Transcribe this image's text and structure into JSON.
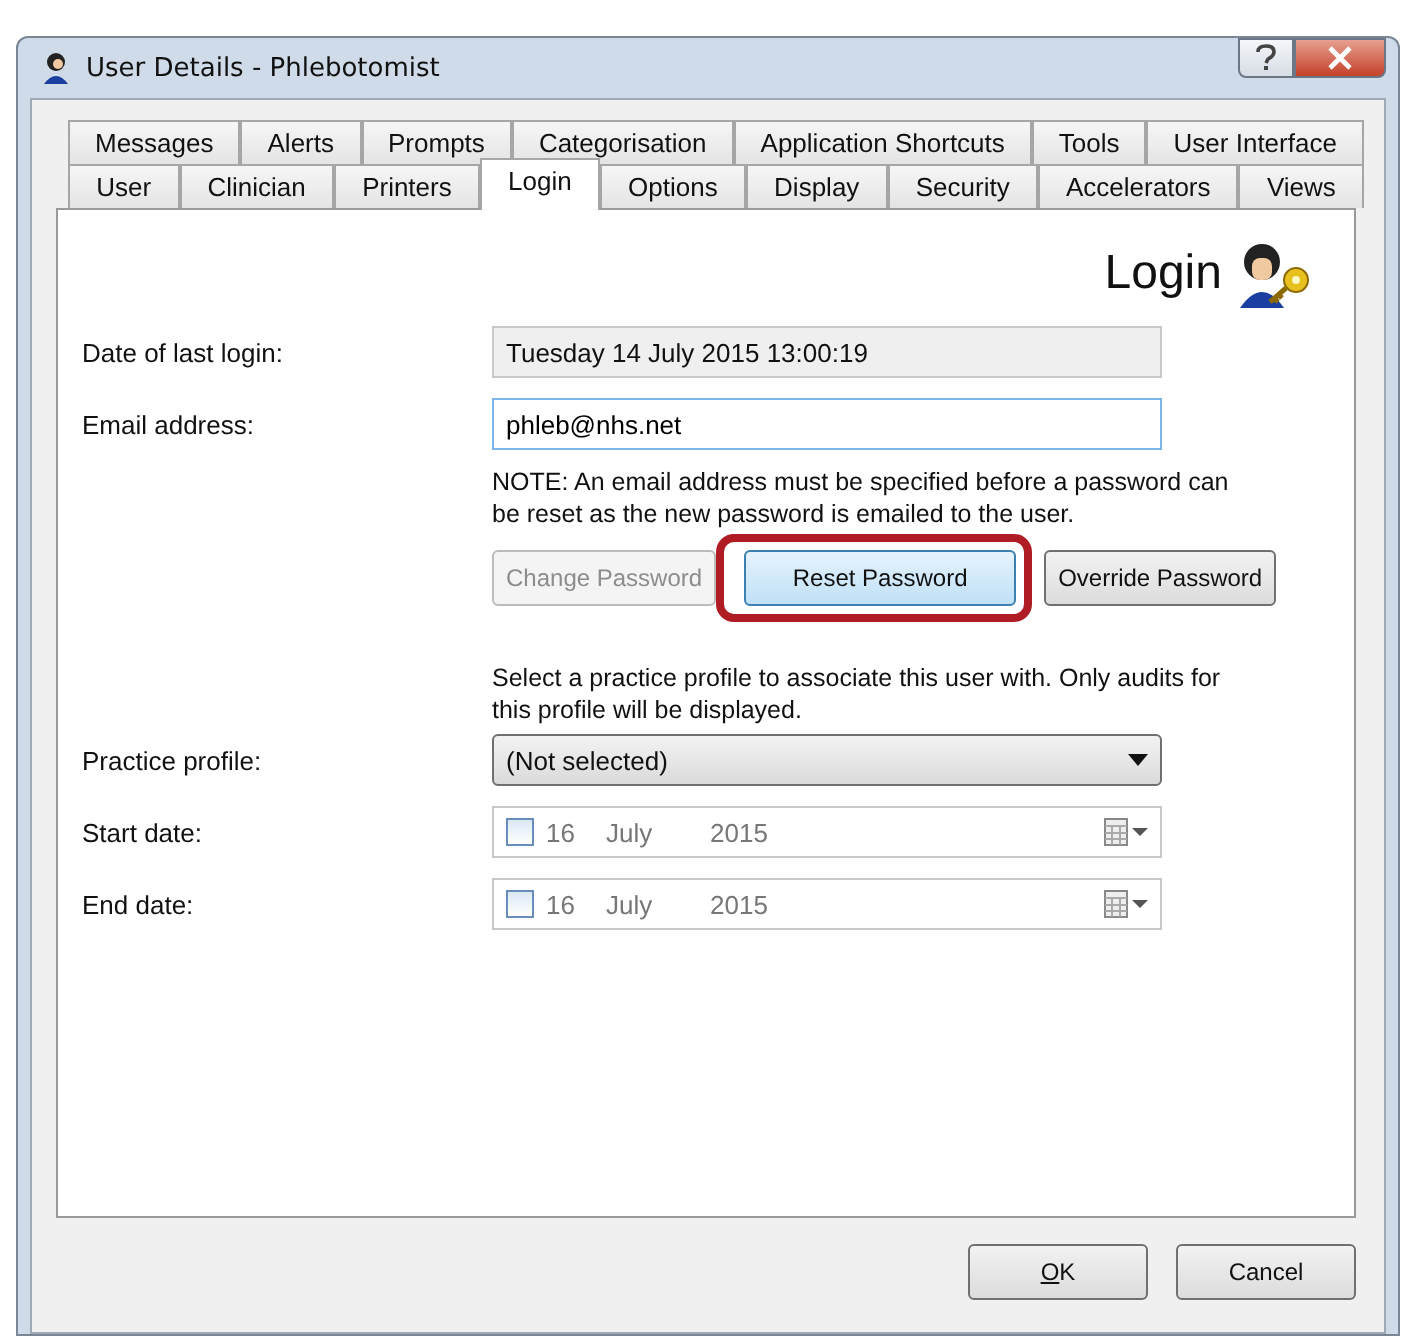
{
  "window": {
    "title": "User Details - Phlebotomist"
  },
  "tab_rows": [
    [
      {
        "label": "Messages",
        "selected": false
      },
      {
        "label": "Alerts",
        "selected": false
      },
      {
        "label": "Prompts",
        "selected": false
      },
      {
        "label": "Categorisation",
        "selected": false
      },
      {
        "label": "Application Shortcuts",
        "selected": false
      },
      {
        "label": "Tools",
        "selected": false
      },
      {
        "label": "User Interface",
        "selected": false
      }
    ],
    [
      {
        "label": "User",
        "selected": false
      },
      {
        "label": "Clinician",
        "selected": false
      },
      {
        "label": "Printers",
        "selected": false
      },
      {
        "label": "Login",
        "selected": true
      },
      {
        "label": "Options",
        "selected": false
      },
      {
        "label": "Display",
        "selected": false
      },
      {
        "label": "Security",
        "selected": false
      },
      {
        "label": "Accelerators",
        "selected": false
      },
      {
        "label": "Views",
        "selected": false
      }
    ]
  ],
  "page": {
    "heading": "Login",
    "last_login": {
      "label": "Date of last login:",
      "value": "Tuesday 14 July 2015 13:00:19"
    },
    "email": {
      "label": "Email address:",
      "value": "phleb@nhs.net"
    },
    "email_note": "NOTE: An email address must be specified before a password can be reset as the new password is emailed to the user.",
    "password_buttons": [
      {
        "label": "Change Password",
        "disabled": true,
        "highlighted": false
      },
      {
        "label": "Reset Password",
        "disabled": false,
        "highlighted": true
      },
      {
        "label": "Override Password",
        "disabled": false,
        "highlighted": false
      }
    ],
    "profile_note": "Select a practice profile to associate this user with. Only audits for this profile will be displayed.",
    "practice_profile": {
      "label": "Practice profile:",
      "value": "(Not selected)"
    },
    "dates": [
      {
        "label": "Start date:",
        "checked": false,
        "day": "16",
        "month": "July",
        "year": "2015"
      },
      {
        "label": "End date:",
        "checked": false,
        "day": "16",
        "month": "July",
        "year": "2015"
      }
    ]
  },
  "buttons": [
    {
      "label_parts": [
        {
          "text": "O",
          "underlined": true
        },
        {
          "text": "K",
          "underlined": false
        }
      ]
    },
    {
      "label_parts": [
        {
          "text": "Cancel",
          "underlined": false
        }
      ]
    }
  ]
}
